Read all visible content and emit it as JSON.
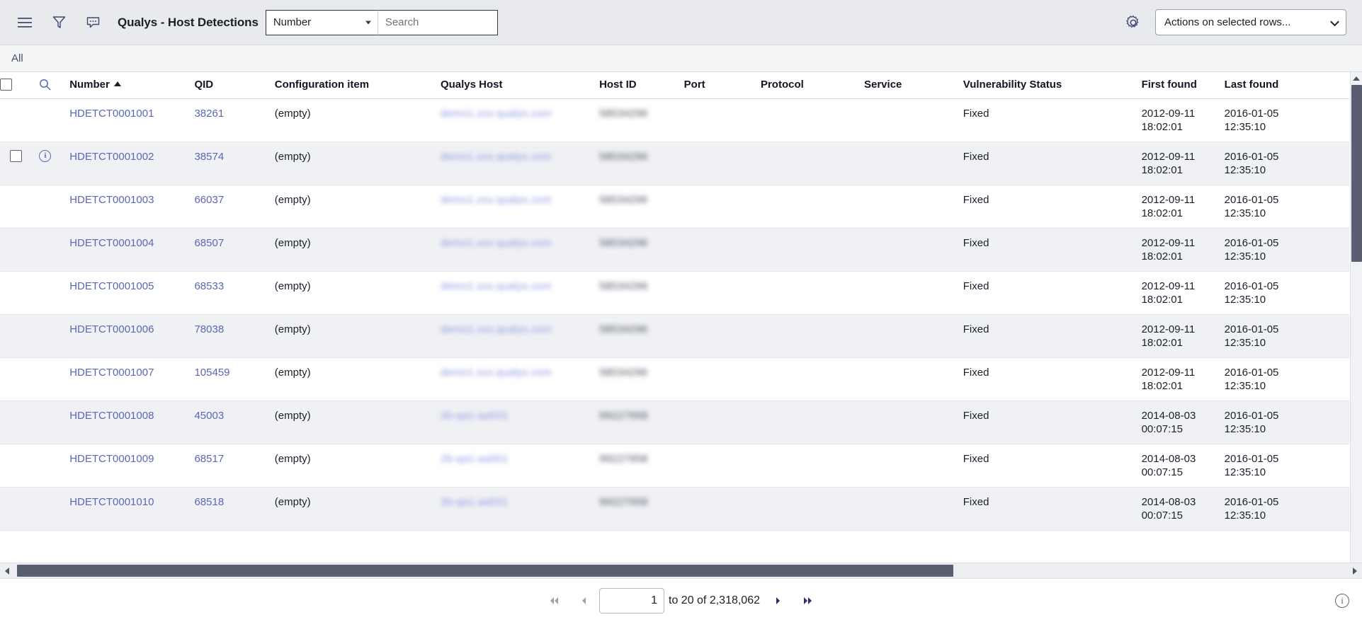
{
  "toolbar": {
    "menu_icon": "hamburger-menu-icon",
    "filter_icon": "funnel-filter-icon",
    "comment_icon": "speech-bubble-icon",
    "title": "Qualys - Host Detections",
    "search_field_selected": "Number",
    "search_field_options": [
      "Number"
    ],
    "search_placeholder": "Search",
    "search_value": "",
    "gear_icon": "gear-icon",
    "actions_selected": "Actions on selected rows...",
    "actions_options": [
      "Actions on selected rows..."
    ]
  },
  "breadcrumb": {
    "items": [
      "All"
    ]
  },
  "table": {
    "columns": [
      {
        "key": "number",
        "label": "Number",
        "sorted": "asc"
      },
      {
        "key": "qid",
        "label": "QID"
      },
      {
        "key": "ci",
        "label": "Configuration item"
      },
      {
        "key": "host",
        "label": "Qualys Host"
      },
      {
        "key": "hostid",
        "label": "Host ID"
      },
      {
        "key": "port",
        "label": "Port"
      },
      {
        "key": "protocol",
        "label": "Protocol"
      },
      {
        "key": "service",
        "label": "Service"
      },
      {
        "key": "vuln",
        "label": "Vulnerability Status"
      },
      {
        "key": "first",
        "label": "First found"
      },
      {
        "key": "last",
        "label": "Last found"
      }
    ],
    "header_search_icon": "search-icon",
    "rows": [
      {
        "number": "HDETCT0001001",
        "qid": "38261",
        "ci": "(empty)",
        "host": "demo1.xxx.qualys.com",
        "hostid": "58534296",
        "port": "",
        "protocol": "",
        "service": "",
        "vuln": "Fixed",
        "first": "2012-09-11\n18:02:01",
        "last": "2016-01-05\n12:35:10",
        "has_info": false,
        "has_checkbox": false
      },
      {
        "number": "HDETCT0001002",
        "qid": "38574",
        "ci": "(empty)",
        "host": "demo1.xxx.qualys.com",
        "hostid": "58534296",
        "port": "",
        "protocol": "",
        "service": "",
        "vuln": "Fixed",
        "first": "2012-09-11\n18:02:01",
        "last": "2016-01-05\n12:35:10",
        "has_info": true,
        "has_checkbox": true
      },
      {
        "number": "HDETCT0001003",
        "qid": "66037",
        "ci": "(empty)",
        "host": "demo1.xxx.qualys.com",
        "hostid": "58534296",
        "port": "",
        "protocol": "",
        "service": "",
        "vuln": "Fixed",
        "first": "2012-09-11\n18:02:01",
        "last": "2016-01-05\n12:35:10",
        "has_info": false,
        "has_checkbox": false
      },
      {
        "number": "HDETCT0001004",
        "qid": "68507",
        "ci": "(empty)",
        "host": "demo1.xxx.qualys.com",
        "hostid": "58534296",
        "port": "",
        "protocol": "",
        "service": "",
        "vuln": "Fixed",
        "first": "2012-09-11\n18:02:01",
        "last": "2016-01-05\n12:35:10",
        "has_info": false,
        "has_checkbox": false
      },
      {
        "number": "HDETCT0001005",
        "qid": "68533",
        "ci": "(empty)",
        "host": "demo1.xxx.qualys.com",
        "hostid": "58534296",
        "port": "",
        "protocol": "",
        "service": "",
        "vuln": "Fixed",
        "first": "2012-09-11\n18:02:01",
        "last": "2016-01-05\n12:35:10",
        "has_info": false,
        "has_checkbox": false
      },
      {
        "number": "HDETCT0001006",
        "qid": "78038",
        "ci": "(empty)",
        "host": "demo1.xxx.qualys.com",
        "hostid": "58534296",
        "port": "",
        "protocol": "",
        "service": "",
        "vuln": "Fixed",
        "first": "2012-09-11\n18:02:01",
        "last": "2016-01-05\n12:35:10",
        "has_info": false,
        "has_checkbox": false
      },
      {
        "number": "HDETCT0001007",
        "qid": "105459",
        "ci": "(empty)",
        "host": "demo1.xxx.qualys.com",
        "hostid": "58534296",
        "port": "",
        "protocol": "",
        "service": "",
        "vuln": "Fixed",
        "first": "2012-09-11\n18:02:01",
        "last": "2016-01-05\n12:35:10",
        "has_info": false,
        "has_checkbox": false
      },
      {
        "number": "HDETCT0001008",
        "qid": "45003",
        "ci": "(empty)",
        "host": "2b-qa1-aa501",
        "hostid": "99227958",
        "port": "",
        "protocol": "",
        "service": "",
        "vuln": "Fixed",
        "first": "2014-08-03\n00:07:15",
        "last": "2016-01-05\n12:35:10",
        "has_info": false,
        "has_checkbox": false
      },
      {
        "number": "HDETCT0001009",
        "qid": "68517",
        "ci": "(empty)",
        "host": "2b-qa1-aa501",
        "hostid": "99227958",
        "port": "",
        "protocol": "",
        "service": "",
        "vuln": "Fixed",
        "first": "2014-08-03\n00:07:15",
        "last": "2016-01-05\n12:35:10",
        "has_info": false,
        "has_checkbox": false
      },
      {
        "number": "HDETCT0001010",
        "qid": "68518",
        "ci": "(empty)",
        "host": "2b-qa1-aa501",
        "hostid": "99227958",
        "port": "",
        "protocol": "",
        "service": "",
        "vuln": "Fixed",
        "first": "2014-08-03\n00:07:15",
        "last": "2016-01-05\n12:35:10",
        "has_info": false,
        "has_checkbox": false
      }
    ]
  },
  "footer": {
    "first_page_icon": "double-left-arrow-icon",
    "prev_page_icon": "left-arrow-icon",
    "page_value": "1",
    "status": "to 20 of 2,318,062",
    "next_page_icon": "right-arrow-icon",
    "last_page_icon": "double-right-arrow-icon",
    "help_icon": "info-icon"
  },
  "colors": {
    "link": "#5b67b5",
    "toolbar_bg": "#e8eaee",
    "row_alt_bg": "#f0f1f5",
    "scrollbar_thumb": "#595f70"
  }
}
